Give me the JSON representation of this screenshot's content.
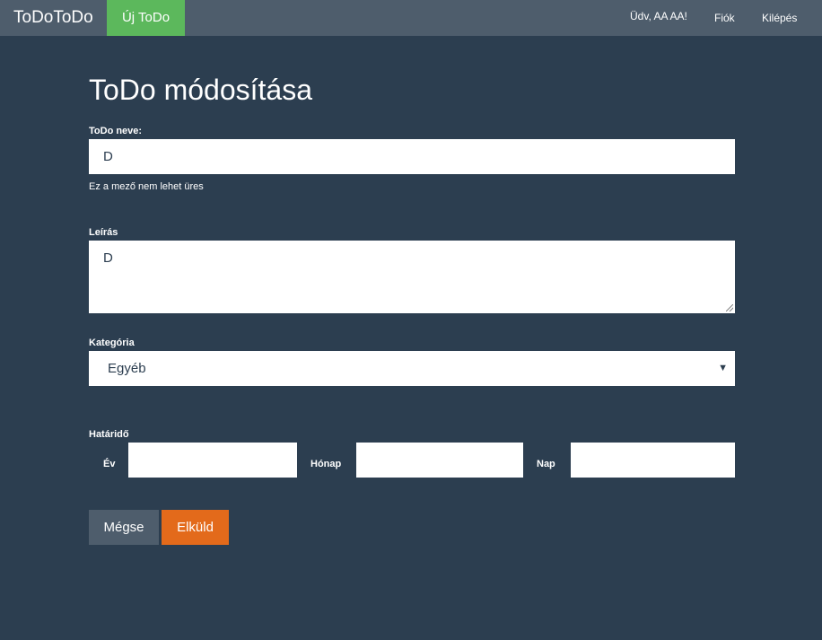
{
  "navbar": {
    "brand": "ToDoToDo",
    "new_todo": "Új ToDo",
    "greeting": "Üdv, AA AA!",
    "account": "Fiók",
    "logout": "Kilépés"
  },
  "form": {
    "title": "ToDo módosítása",
    "name_label": "ToDo neve:",
    "name_value": "D",
    "name_error": "Ez a mező nem lehet üres",
    "description_label": "Leírás",
    "description_value": "D",
    "category_label": "Kategória",
    "category_selected": "Egyéb",
    "deadline_label": "Határidő",
    "year_label": "Év",
    "year_value": "",
    "month_label": "Hónap",
    "month_value": "",
    "day_label": "Nap",
    "day_value": "",
    "cancel_label": "Mégse",
    "submit_label": "Elküld"
  },
  "colors": {
    "background": "#2c3e50",
    "navbar": "#4e5d6c",
    "new_todo": "#5cb85c",
    "submit": "#e36a1b",
    "cancel": "#4e5d6c"
  }
}
